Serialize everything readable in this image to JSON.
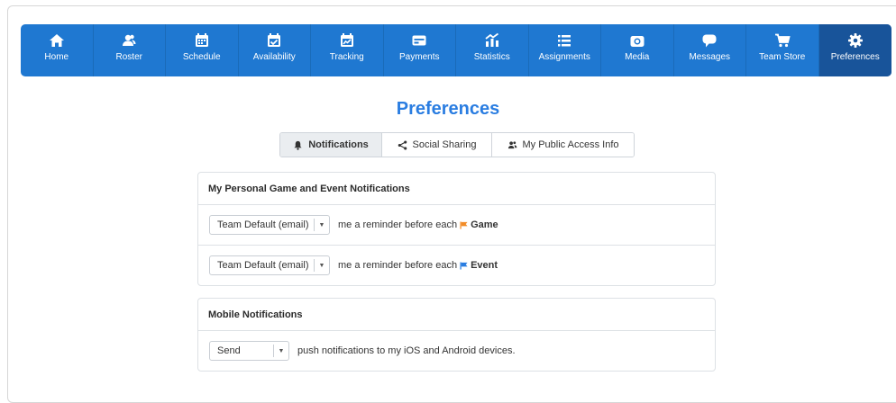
{
  "nav": {
    "items": [
      {
        "label": "Home",
        "icon": "home-icon"
      },
      {
        "label": "Roster",
        "icon": "users-icon"
      },
      {
        "label": "Schedule",
        "icon": "calendar-icon"
      },
      {
        "label": "Availability",
        "icon": "calendar-check-icon"
      },
      {
        "label": "Tracking",
        "icon": "calendar-chart-icon"
      },
      {
        "label": "Payments",
        "icon": "credit-card-icon"
      },
      {
        "label": "Statistics",
        "icon": "bar-chart-icon"
      },
      {
        "label": "Assignments",
        "icon": "list-icon"
      },
      {
        "label": "Media",
        "icon": "camera-icon"
      },
      {
        "label": "Messages",
        "icon": "speech-bubble-icon"
      },
      {
        "label": "Team Store",
        "icon": "cart-icon"
      },
      {
        "label": "Preferences",
        "icon": "gear-icon"
      }
    ],
    "active": "Preferences",
    "color": "#1f78d1",
    "active_color": "#18549a"
  },
  "page": {
    "title": "Preferences",
    "title_color": "#2a7de1"
  },
  "tabs": [
    {
      "label": "Notifications",
      "icon": "bell-icon",
      "active": true
    },
    {
      "label": "Social Sharing",
      "icon": "share-icon",
      "active": false
    },
    {
      "label": "My Public Access Info",
      "icon": "users-icon",
      "active": false
    }
  ],
  "personal": {
    "heading": "My Personal Game and Event Notifications",
    "rows": [
      {
        "select": "Team Default (email)",
        "text": "me a reminder before each",
        "item": "Game",
        "flag_color": "#f28c28"
      },
      {
        "select": "Team Default (email)",
        "text": "me a reminder before each",
        "item": "Event",
        "flag_color": "#2a7de1"
      }
    ]
  },
  "mobile": {
    "heading": "Mobile Notifications",
    "row": {
      "select": "Send",
      "text": "push notifications to my iOS and Android devices."
    }
  }
}
